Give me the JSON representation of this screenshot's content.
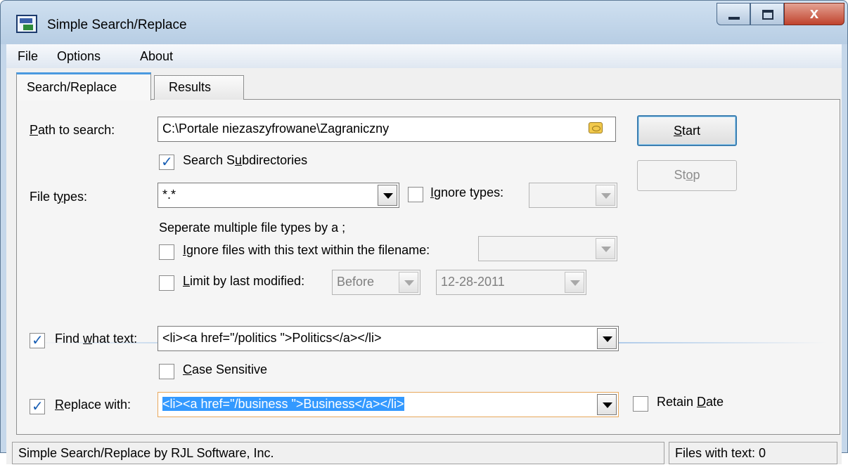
{
  "window": {
    "title": "Simple Search/Replace",
    "close_glyph": "x",
    "icon": "app-icon"
  },
  "menu": {
    "items": [
      "File",
      "Options",
      "About"
    ]
  },
  "tabs": [
    {
      "label": "Search/Replace",
      "active": true
    },
    {
      "label": "Results",
      "active": false
    }
  ],
  "path": {
    "label_first": "P",
    "label_rest": "ath to search:",
    "value": "C:\\Portale niezaszyfrowane\\Zagraniczny",
    "browse_icon": "folder-icon"
  },
  "subdirs": {
    "label_pre": "Search S",
    "label_ul": "u",
    "label_post": "bdirectories",
    "checked": true
  },
  "file_types": {
    "label_pre": "File t",
    "label_ul": "y",
    "label_post": "pes:",
    "value": "*.*",
    "hint": "Seperate multiple file types by a ;"
  },
  "ignore_types": {
    "label_ul": "I",
    "label_post": "gnore types:",
    "checked": false,
    "value": ""
  },
  "ignore_files": {
    "label_ul": "Ig",
    "label_post": "nore files with this text within the filename:",
    "checked": false,
    "value": ""
  },
  "limit_modified": {
    "label_ul": "L",
    "label_post": "imit by last modified:",
    "checked": false,
    "when": "Before",
    "date": "12-28-2011"
  },
  "find": {
    "label_pre": "Find ",
    "label_ul": "w",
    "label_post": "hat text:",
    "checked": true,
    "value": "<li><a href=\"/politics \">Politics</a></li>"
  },
  "case_sensitive": {
    "label_ul": "C",
    "label_post": "ase Sensitive",
    "checked": false
  },
  "replace": {
    "label_ul": "R",
    "label_post": "eplace with:",
    "checked": true,
    "value": "<li><a href=\"/business \">Business</a></li>"
  },
  "retain_date": {
    "label_pre": "Retain ",
    "label_ul": "D",
    "label_post": "ate",
    "checked": false
  },
  "buttons": {
    "start_ul": "S",
    "start_rest": "tart",
    "stop_pre": "St",
    "stop_ul": "o",
    "stop_post": "p"
  },
  "status": {
    "left": "Simple Search/Replace by RJL Software, Inc.",
    "right": "Files with text: 0"
  },
  "colors": {
    "selection": "#3399ff",
    "accent": "#4a9ae0",
    "check": "#1a5fb4"
  }
}
